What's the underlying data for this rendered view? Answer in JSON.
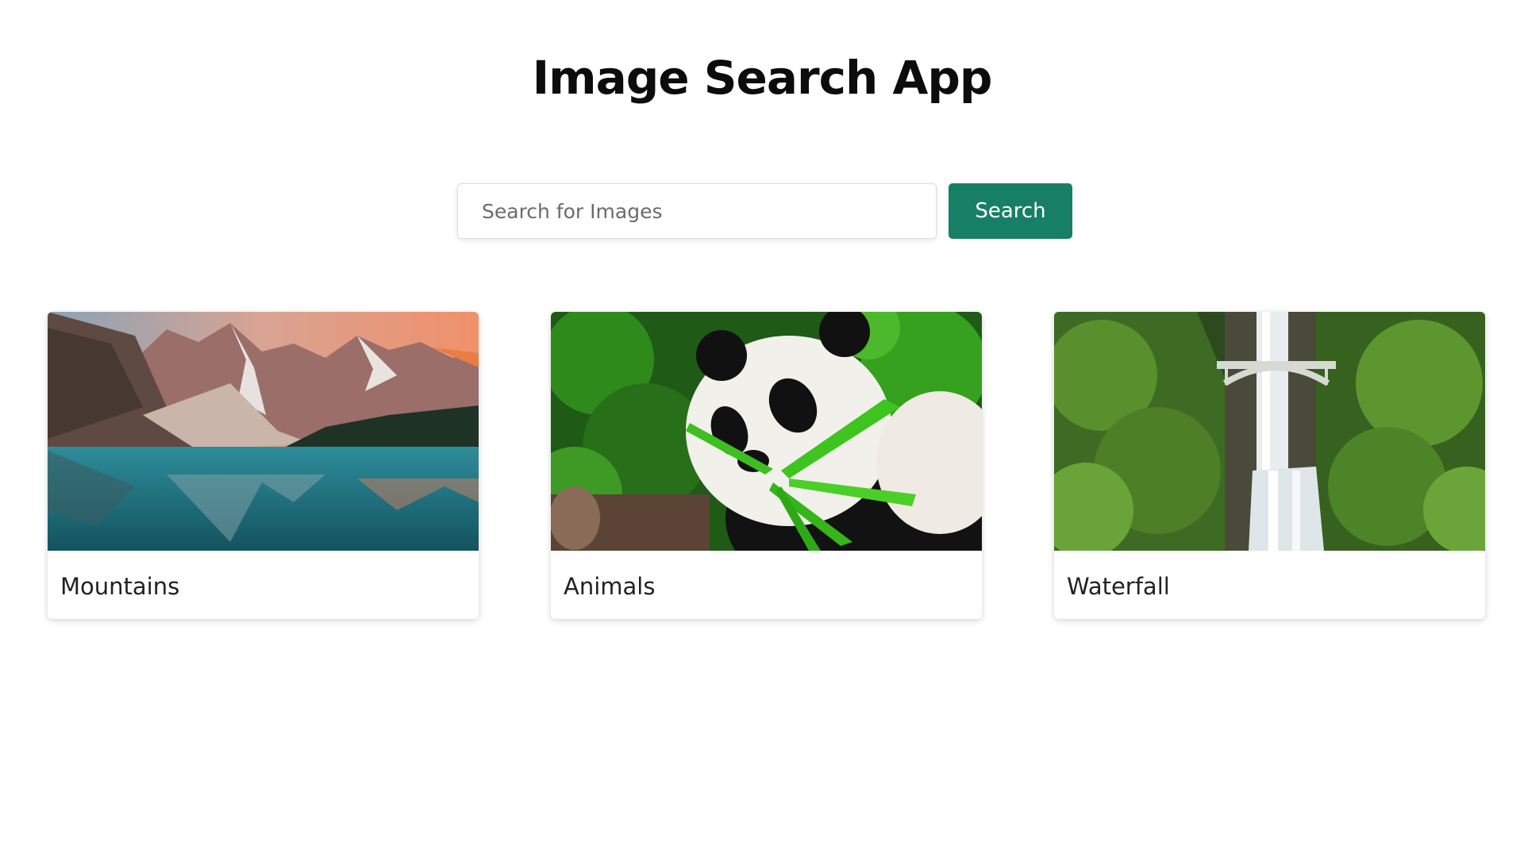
{
  "header": {
    "title": "Image Search App"
  },
  "search": {
    "placeholder": "Search for Images",
    "value": "",
    "button_label": "Search"
  },
  "results": [
    {
      "label": "Mountains",
      "image": "mountain-lake-image"
    },
    {
      "label": "Animals",
      "image": "panda-eating-bamboo-image"
    },
    {
      "label": "Waterfall",
      "image": "waterfall-bridge-image"
    }
  ],
  "colors": {
    "accent": "#177f66",
    "background": "#ffffff",
    "title": "#0c0c0c"
  }
}
